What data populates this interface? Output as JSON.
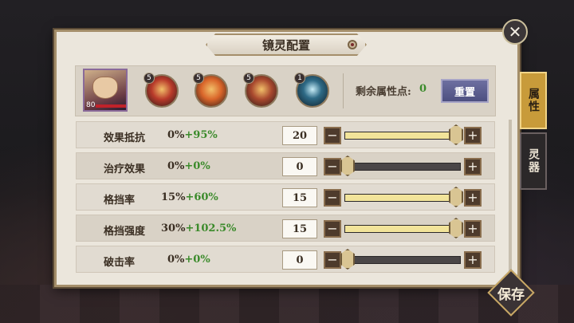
{
  "title": "镜灵配置",
  "hero": {
    "level": "80"
  },
  "skills": [
    {
      "name": "skill-1",
      "level": "5",
      "color": "#b83a2a"
    },
    {
      "name": "skill-2",
      "level": "5",
      "color": "#d9652a"
    },
    {
      "name": "skill-3",
      "level": "5",
      "color": "#a8482e"
    },
    {
      "name": "skill-4",
      "level": "1",
      "color": "#2e6a86"
    }
  ],
  "points": {
    "label": "剩余属性点:",
    "value": "0"
  },
  "reset_label": "重置",
  "rows": [
    {
      "name": "效果抵抗",
      "base": "0%",
      "bonus": "+95%",
      "value": "20",
      "fill": 1.0
    },
    {
      "name": "治疗效果",
      "base": "0%",
      "bonus": "+0%",
      "value": "0",
      "fill": 0.0
    },
    {
      "name": "格挡率",
      "base": "15%",
      "bonus": "+60%",
      "value": "15",
      "fill": 1.0
    },
    {
      "name": "格挡强度",
      "base": "30%",
      "bonus": "+102.5%",
      "value": "15",
      "fill": 1.0
    },
    {
      "name": "破击率",
      "base": "0%",
      "bonus": "+0%",
      "value": "0",
      "fill": 0.0
    }
  ],
  "tabs": {
    "attributes": "属性",
    "spirit": "灵器"
  },
  "save_label": "保存",
  "colors": {
    "accent": "#c89b3a",
    "bonus": "#3a8a2a",
    "reset": "#5d5f90"
  }
}
